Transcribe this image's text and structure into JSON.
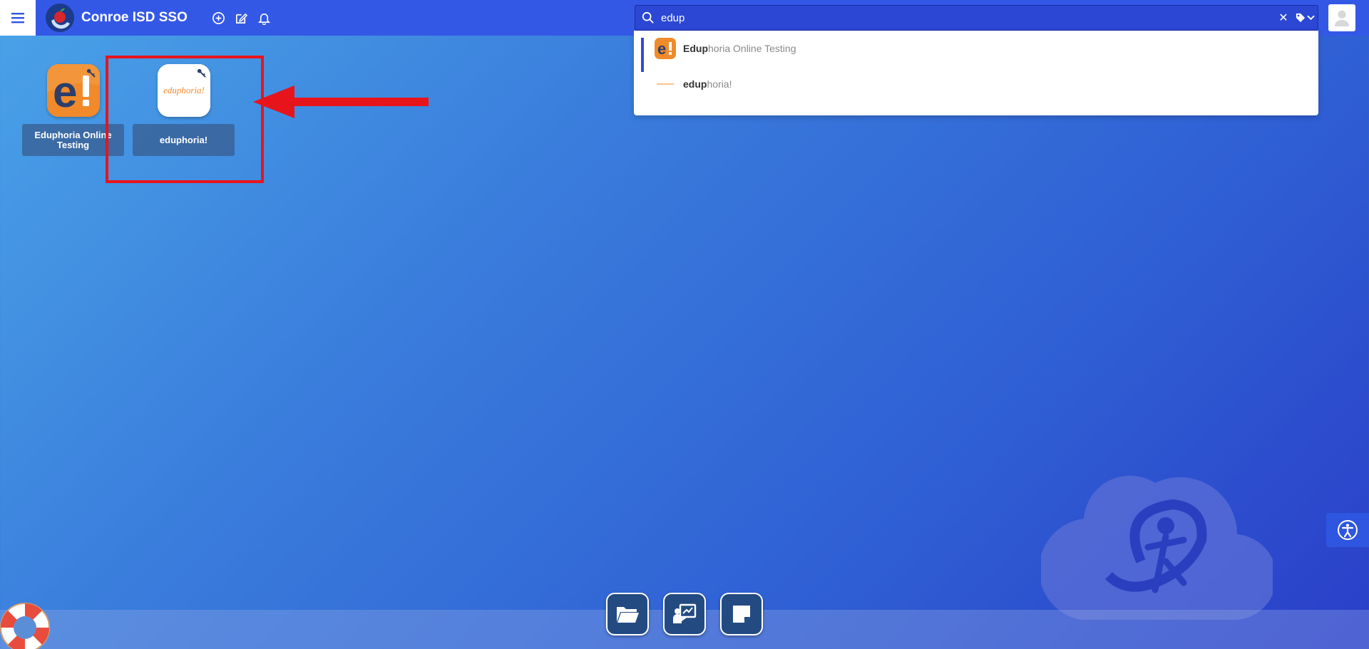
{
  "app": {
    "title": "Conroe ISD SSO"
  },
  "search": {
    "value": "edup",
    "clear_symbol": "✕"
  },
  "dropdown": {
    "items": [
      {
        "match": "Edup",
        "rest": "horia Online Testing"
      },
      {
        "match": "edup",
        "rest": "horia!"
      }
    ]
  },
  "tiles": [
    {
      "label": "Eduphoria Online Testing"
    },
    {
      "label": "eduphoria!",
      "logo_text": "eduphoria!"
    }
  ],
  "icons": {
    "menu": "hamburger-icon",
    "add": "plus-circle-icon",
    "edit": "edit-icon",
    "notifications": "bell-icon",
    "search": "search-icon",
    "tag": "tag-icon",
    "user": "user-icon",
    "folder": "folder-icon",
    "presentation": "presentation-icon",
    "note": "sticky-note-icon",
    "help": "lifebuoy-icon",
    "accessibility": "accessibility-icon"
  },
  "colors": {
    "topbar": "#3458e6",
    "accent": "#3449d8",
    "highlight": "#e8141b",
    "eduphoria_orange": "#f08a2a"
  }
}
